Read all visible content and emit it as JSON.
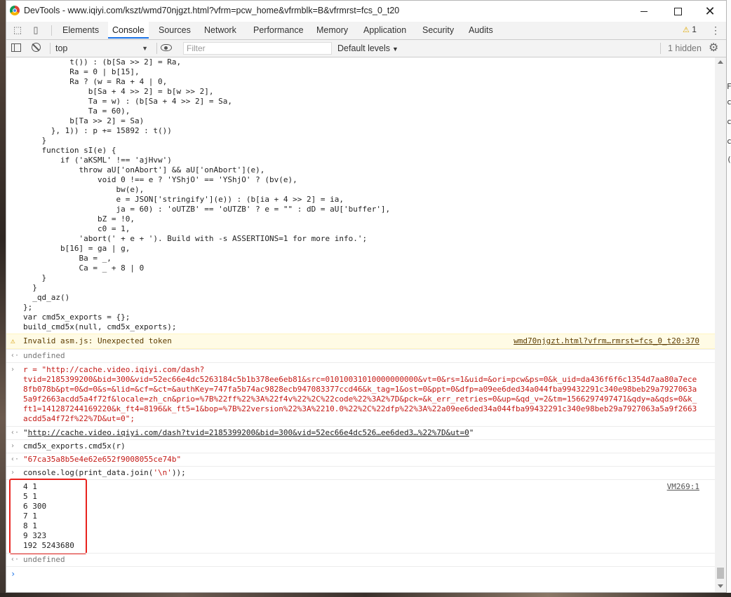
{
  "window": {
    "title": "DevTools - www.iqiyi.com/kszt/wmd70njgzt.html?vfrm=pcw_home&vfrmblk=B&vfrmrst=fcs_0_t20"
  },
  "tabs": [
    "Elements",
    "Console",
    "Sources",
    "Network",
    "Performance",
    "Memory",
    "Application",
    "Security",
    "Audits"
  ],
  "active_tab": "Console",
  "warnings_count": "1",
  "filterbar": {
    "context": "top",
    "filter_placeholder": "Filter",
    "levels": "Default levels",
    "hidden": "1 hidden"
  },
  "console": {
    "code_block": "          t()) : (b[Sa >> 2] = Ra,\n          Ra = 0 | b[15],\n          Ra ? (w = Ra + 4 | 0,\n              b[Sa + 4 >> 2] = b[w >> 2],\n              Ta = w) : (b[Sa + 4 >> 2] = Sa,\n              Ta = 60),\n          b[Ta >> 2] = Sa)\n      }, 1)) : p += 15892 : t())\n    }\n    function sI(e) {\n        if ('aKSML' !== 'ajHvw')\n            throw aU['onAbort'] && aU['onAbort'](e),\n                void 0 !== e ? 'YShjO' == 'YShjO' ? (bv(e),\n                    bw(e),\n                    e = JSON['stringify'](e)) : (b[ia + 4 >> 2] = ia,\n                    ja = 60) : 'oUTZB' == 'oUTZB' ? e = \"\" : dD = aU['buffer'],\n                bZ = !0,\n                c0 = 1,\n            'abort(' + e + '). Build with -s ASSERTIONS=1 for more info.';\n        b[16] = ga | g,\n            Ba = _,\n            Ca = _ + 8 | 0\n    }\n  }\n  _qd_az()\n};\nvar cmd5x_exports = {};\nbuild_cmd5x(null, cmd5x_exports);",
    "warning_text": "Invalid asm.js: Unexpected token",
    "warning_source": "wmd70njgzt.html?vfrm…rmrst=fcs_0_t20:370",
    "undefined_1": "undefined",
    "r_input_prefix": "r = ",
    "r_input_value": "\"http://cache.video.iqiyi.com/dash?\ntvid=2185399200&bid=300&vid=52ec66e4dc5263184c5b1b378ee6eb81&src=01010031010000000000&vt=0&rs=1&uid=&ori=pcw&ps=0&k_uid=da436f6f6c1354d7aa80a7ece\n8fb078b&pt=0&d=0&s=&lid=&cf=&ct=&authKey=747fa5b74ac9828ecb947083377ccd46&k_tag=1&ost=0&ppt=0&dfp=a09ee6ded34a044fba99432291c340e98beb29a7927063a\n5a9f2663acdd5a4f72f&locale=zh_cn&prio=%7B%22ff%22%3A%22f4v%22%2C%22code%22%3A2%7D&pck=&k_err_retries=0&up=&qd_v=2&tm=1566297497471&qdy=a&qds=0&k_\nft1=141287244169220&k_ft4=8196&k_ft5=1&bop=%7B%22version%22%3A%2210.0%22%2C%22dfp%22%3A%22a09ee6ded34a044fba99432291c340e98beb29a7927063a5a9f2663\nacdd5a4f72f%22%7D&ut=0\";",
    "r_output_prefix": "\"",
    "r_output_link": "http://cache.video.iqiyi.com/dash?tvid=2185399200&bid=300&vid=52ec66e4dc526…ee6ded3…%22%7D&ut=0",
    "r_output_suffix": "\"",
    "cmd_input": "cmd5x_exports.cmd5x(r)",
    "cmd_output": "\"67ca35a8b5e4e62e652f9008055ce74b\"",
    "log_input_prefix": "console.log(print_data.join(",
    "log_input_arg": "'\\n'",
    "log_input_suffix": "));",
    "log_output": "4 1\n5 1\n6 300\n7 1\n8 1\n9 323\n192 5243680",
    "log_source": "VM269:1",
    "undefined_2": "undefined"
  },
  "background": {
    "right_edge_fragments": [
      "F",
      "c",
      "c",
      "c",
      "(易"
    ]
  },
  "colors": {
    "accent": "#1a73e8",
    "error_red": "#c41a16",
    "warning_bg": "#fffbe5",
    "highlight_box": "#e8221d"
  }
}
